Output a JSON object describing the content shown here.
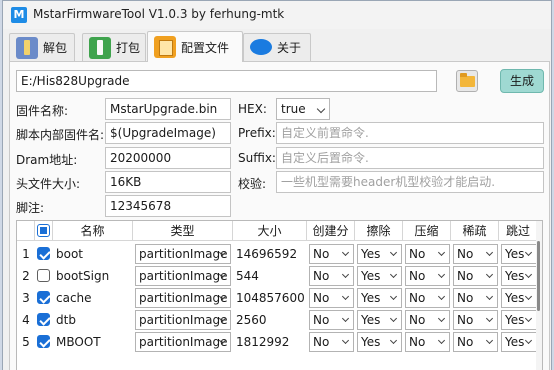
{
  "window": {
    "title": "MstarFirmwareTool V1.0.3 by ferhung-mtk"
  },
  "tabs": [
    {
      "label": "解包",
      "icon": "unpack-icon"
    },
    {
      "label": "打包",
      "icon": "pack-icon"
    },
    {
      "label": "配置文件",
      "icon": "config-file-icon"
    },
    {
      "label": "关于",
      "icon": "about-chat-icon"
    }
  ],
  "toolbar": {
    "path_value": "E:/His828Upgrade",
    "generate_label": "生成"
  },
  "form": {
    "firmware_name_label": "固件名称:",
    "firmware_name_value": "MstarUpgrade.bin",
    "hex_label": "HEX:",
    "hex_value": "true",
    "script_name_label": "脚本内部固件名:",
    "script_name_value": "$(UpgradeImage)",
    "prefix_label": "Prefix:",
    "prefix_placeholder": "自定义前置命令.",
    "dram_label": "Dram地址:",
    "dram_value": "20200000",
    "suffix_label": "Suffix:",
    "suffix_placeholder": "自定义后置命令.",
    "header_size_label": "头文件大小:",
    "header_size_value": "16KB",
    "verify_label": "校验:",
    "verify_placeholder": "一些机型需要header机型校验才能启动.",
    "note_label": "脚注:",
    "note_value": "12345678"
  },
  "table": {
    "headers": [
      "名称",
      "类型",
      "大小",
      "创建分区",
      "擦除",
      "压缩",
      "稀疏",
      "跳过"
    ],
    "rows": [
      {
        "num": "1",
        "checked": true,
        "name": "boot",
        "type": "partitionImage",
        "size": "14696592",
        "create": "No",
        "erase": "Yes",
        "compress": "No",
        "sparse": "No",
        "skip": "Yes"
      },
      {
        "num": "2",
        "checked": false,
        "name": "bootSign",
        "type": "partitionImage",
        "size": "544",
        "create": "No",
        "erase": "Yes",
        "compress": "No",
        "sparse": "No",
        "skip": "Yes"
      },
      {
        "num": "3",
        "checked": true,
        "name": "cache",
        "type": "partitionImage",
        "size": "104857600",
        "create": "No",
        "erase": "Yes",
        "compress": "No",
        "sparse": "No",
        "skip": "Yes"
      },
      {
        "num": "4",
        "checked": true,
        "name": "dtb",
        "type": "partitionImage",
        "size": "2560",
        "create": "No",
        "erase": "Yes",
        "compress": "No",
        "sparse": "No",
        "skip": "Yes"
      },
      {
        "num": "5",
        "checked": true,
        "name": "MBOOT",
        "type": "partitionImage",
        "size": "1812992",
        "create": "No",
        "erase": "Yes",
        "compress": "No",
        "sparse": "No",
        "skip": "Yes"
      }
    ]
  },
  "colors": {
    "accent": "#1a6fd6",
    "generate_button": "#9fd9d2"
  }
}
